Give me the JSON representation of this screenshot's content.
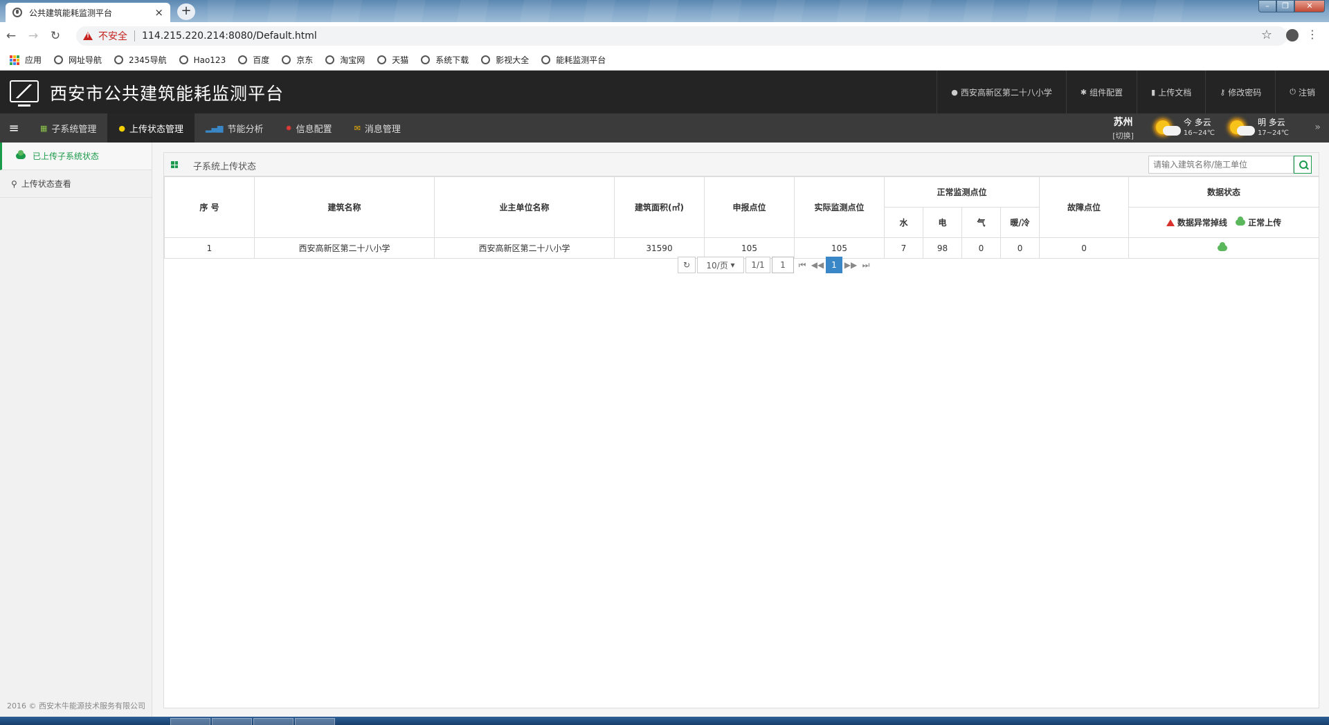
{
  "browser": {
    "tab_title": "公共建筑能耗监测平台",
    "tab_close": "×",
    "new_tab": "+",
    "insecure_label": "不安全",
    "url": "114.215.220.214:8080/Default.html",
    "bookmarks": [
      "应用",
      "网址导航",
      "2345导航",
      "Hao123",
      "百度",
      "京东",
      "淘宝网",
      "天猫",
      "系统下载",
      "影视大全",
      "能耗监测平台"
    ]
  },
  "header": {
    "title": "西安市公共建筑能耗监测平台",
    "links": [
      {
        "icon": "user-icon",
        "label": "西安高新区第二十八小学"
      },
      {
        "icon": "gear-icon",
        "label": "组件配置"
      },
      {
        "icon": "book-icon",
        "label": "上传文档"
      },
      {
        "icon": "key-icon",
        "label": "修改密码"
      },
      {
        "icon": "power-icon",
        "label": "注销"
      }
    ]
  },
  "nav": {
    "items": [
      {
        "icon": "grid-icon",
        "label": "子系统管理",
        "active": false
      },
      {
        "icon": "alert-circle-icon",
        "label": "上传状态管理",
        "active": true
      },
      {
        "icon": "bar-chart-icon",
        "label": "节能分析",
        "active": false
      },
      {
        "icon": "cog-icon",
        "label": "信息配置",
        "active": false
      },
      {
        "icon": "envelope-icon",
        "label": "消息管理",
        "active": false
      }
    ],
    "weather": {
      "city": "苏州",
      "switch": "[切换]",
      "today": {
        "label": "今 多云",
        "temp": "16~24℃"
      },
      "tomorrow": {
        "label": "明 多云",
        "temp": "17~24℃"
      }
    }
  },
  "sidebar": {
    "items": [
      {
        "icon": "cloud-upload-icon",
        "label": "已上传子系统状态",
        "active": true
      },
      {
        "icon": "search-icon",
        "label": "上传状态查看",
        "active": false
      }
    ],
    "copyright": "2016 © 西安木牛能源技术服务有限公司"
  },
  "panel": {
    "title": "子系统上传状态",
    "search_placeholder": "请输入建筑名称/施工单位"
  },
  "table": {
    "headers": {
      "index": "序 号",
      "building": "建筑名称",
      "owner": "业主单位名称",
      "area": "建筑面积(㎡)",
      "declared": "申报点位",
      "actual": "实际监测点位",
      "normal": "正常监测点位",
      "water": "水",
      "electric": "电",
      "gas": "气",
      "heat_cool": "暖/冷",
      "fault": "故障点位",
      "data_status": "数据状态",
      "legend_warn": "数据异常掉线",
      "legend_ok": "正常上传"
    },
    "rows": [
      {
        "index": "1",
        "building": "西安高新区第二十八小学",
        "owner": "西安高新区第二十八小学",
        "area": "31590",
        "declared": "105",
        "actual": "105",
        "water": "7",
        "electric": "98",
        "gas": "0",
        "heat_cool": "0",
        "fault": "0",
        "status": "normal-upload"
      }
    ]
  },
  "pager": {
    "page_size": "10/页",
    "page_count": "1/1",
    "page_input": "1",
    "current": "1"
  },
  "colors": {
    "accent_green": "#1a9a4a",
    "header_bg": "#242424",
    "nav_bg": "#3b3b3b",
    "pager_active": "#3a87c8",
    "warn_red": "#d9322e"
  }
}
